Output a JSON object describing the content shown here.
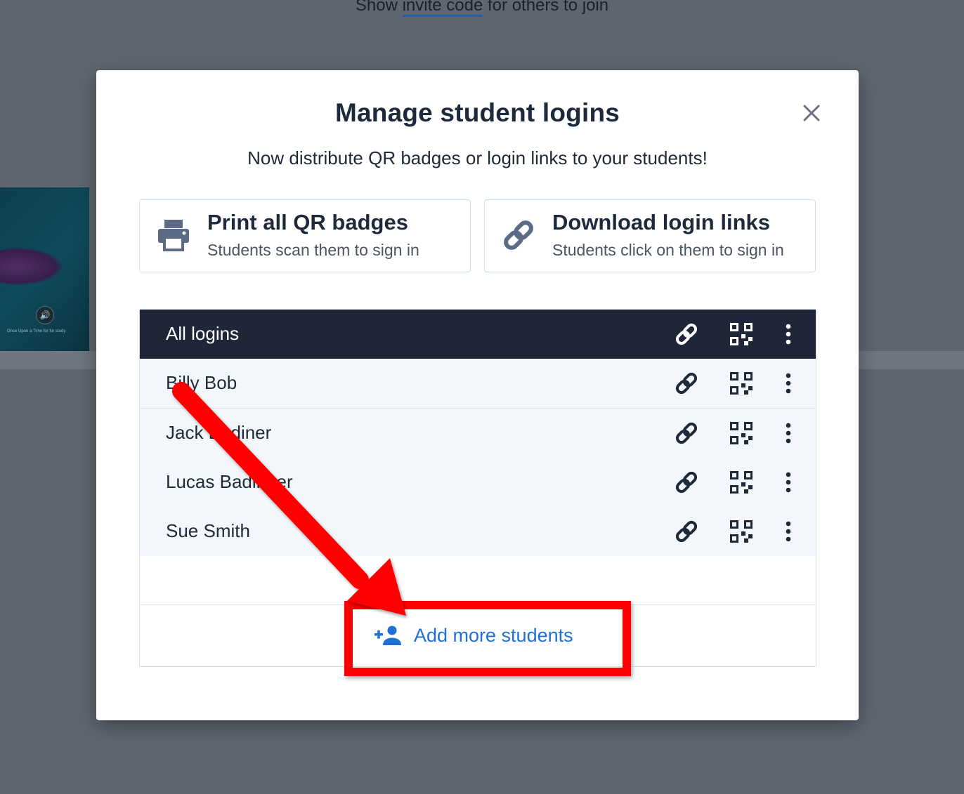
{
  "background": {
    "top_text_before": "Show ",
    "top_text_link": "invite code",
    "top_text_after": " for others to join",
    "thumbnail_caption": "Once Upon a Time for for study"
  },
  "modal": {
    "title": "Manage student logins",
    "subtitle": "Now distribute QR badges or login links to your students!",
    "cards": [
      {
        "title": "Print all QR badges",
        "subtitle": "Students scan them to sign in",
        "icon": "printer-icon"
      },
      {
        "title": "Download login links",
        "subtitle": "Students click on them to sign in",
        "icon": "link-icon"
      }
    ],
    "table": {
      "header": "All logins",
      "rows": [
        {
          "name": "Billy Bob"
        },
        {
          "name": "Jack Bodiner"
        },
        {
          "name": "Lucas Badinger"
        },
        {
          "name": "Sue Smith"
        }
      ]
    },
    "add_button_label": "Add more students"
  },
  "colors": {
    "header_bg": "#1e2638",
    "accent": "#1f6fd6",
    "highlight": "#ff0000",
    "overlay": "#5f6670"
  }
}
